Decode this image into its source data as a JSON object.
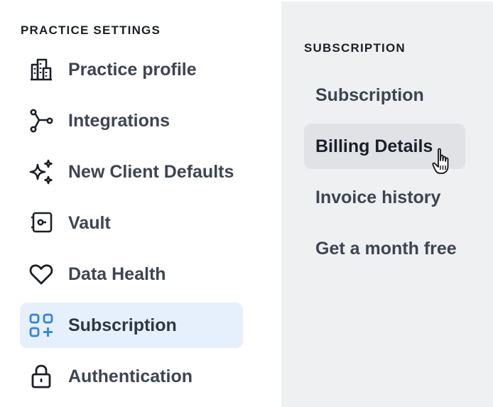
{
  "practice_settings": {
    "title": "PRACTICE SETTINGS",
    "items": [
      {
        "label": "Practice profile",
        "icon": "building-icon"
      },
      {
        "label": "Integrations",
        "icon": "integrations-icon"
      },
      {
        "label": "New Client Defaults",
        "icon": "sparkles-icon"
      },
      {
        "label": "Vault",
        "icon": "vault-icon"
      },
      {
        "label": "Data Health",
        "icon": "heart-icon"
      },
      {
        "label": "Subscription",
        "icon": "apps-plus-icon",
        "active": true
      },
      {
        "label": "Authentication",
        "icon": "lock-icon"
      }
    ]
  },
  "subscription_menu": {
    "title": "SUBSCRIPTION",
    "items": [
      {
        "label": "Subscription"
      },
      {
        "label": "Billing Details",
        "active": true
      },
      {
        "label": "Invoice history"
      },
      {
        "label": "Get a month free"
      }
    ]
  },
  "colors": {
    "active_bg": "#e6f0fc",
    "active_icon": "#2f80ed",
    "submenu_bg": "#eff0f2",
    "submenu_active_bg": "#e0e2e6",
    "text": "#3d4552"
  }
}
